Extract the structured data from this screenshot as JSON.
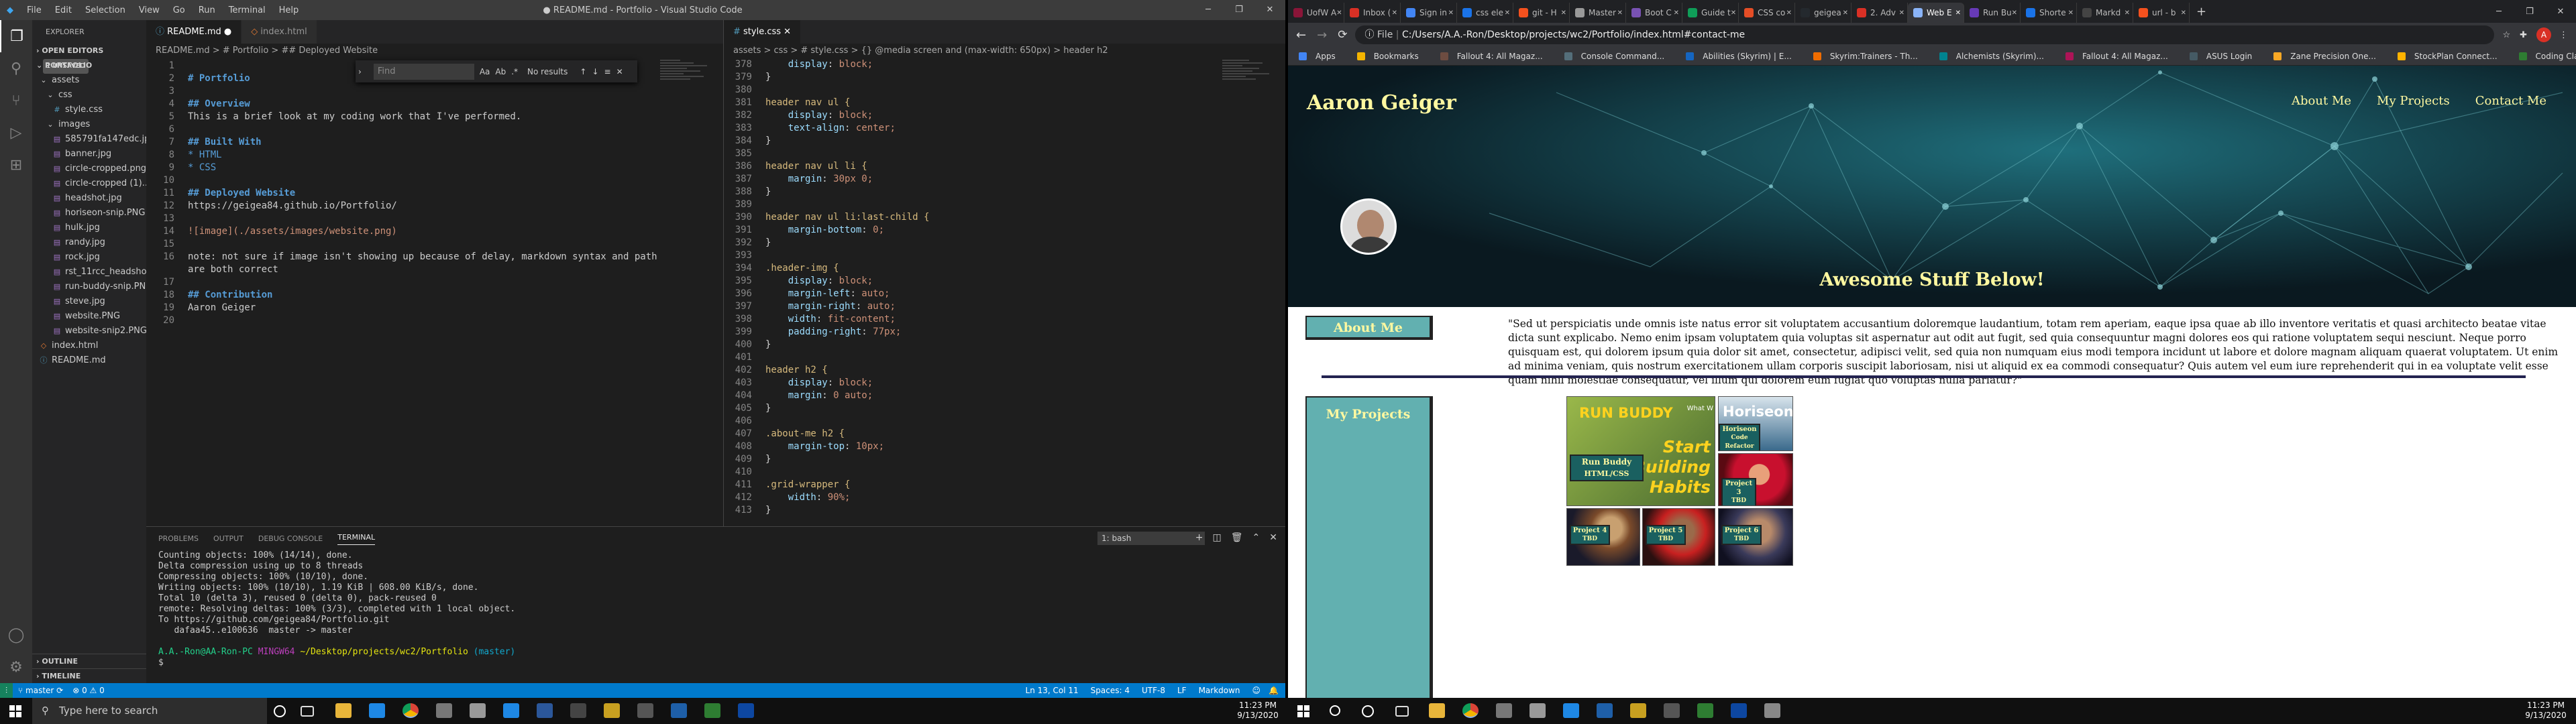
{
  "vscode": {
    "menu": [
      "File",
      "Edit",
      "Selection",
      "View",
      "Go",
      "Run",
      "Terminal",
      "Help"
    ],
    "title": "● README.md - Portfolio - Visual Studio Code",
    "explorer": {
      "header": "EXPLORER",
      "open_editors": "OPEN EDITORS",
      "unsaved": "1 UNSAVED",
      "portfolio": "PORTFOLIO",
      "items": [
        "assets",
        "css",
        "style.css",
        "images",
        "585791fa147edc.jpg",
        "banner.jpg",
        "circle-cropped.png",
        "circle-cropped (1)....",
        "headshot.jpg",
        "horiseon-snip.PNG",
        "hulk.jpg",
        "randy.jpg",
        "rock.jpg",
        "rst_11rcc_headshot...",
        "run-buddy-snip.PNG",
        "steve.jpg",
        "website.PNG",
        "website-snip2.PNG",
        "index.html",
        "README.md"
      ],
      "outline": "OUTLINE",
      "timeline": "TIMELINE"
    },
    "left_editor": {
      "tabs": [
        "README.md",
        "index.html"
      ],
      "breadcrumb": "README.md > # Portfolio > ## Deployed Website",
      "find": {
        "placeholder": "Find",
        "aa": "Aa",
        "ab": "Ab",
        "re": ".*",
        "result": "No results"
      },
      "lines": [
        {
          "n": "1",
          "t": ""
        },
        {
          "n": "2",
          "t": "# Portfolio"
        },
        {
          "n": "3",
          "t": ""
        },
        {
          "n": "4",
          "t": "## Overview"
        },
        {
          "n": "5",
          "t": "This is a brief look at my coding work that I've performed."
        },
        {
          "n": "6",
          "t": ""
        },
        {
          "n": "7",
          "t": "## Built With"
        },
        {
          "n": "8",
          "t": "* HTML"
        },
        {
          "n": "9",
          "t": "* CSS"
        },
        {
          "n": "10",
          "t": ""
        },
        {
          "n": "11",
          "t": "## Deployed Website"
        },
        {
          "n": "12",
          "t": "https://geigea84.github.io/Portfolio/"
        },
        {
          "n": "13",
          "t": ""
        },
        {
          "n": "14",
          "t": "![image](./assets/images/website.png)"
        },
        {
          "n": "15",
          "t": ""
        },
        {
          "n": "16",
          "t": "note: not sure if image isn't showing up because of delay, markdown syntax and path"
        },
        {
          "n": "",
          "t": "are both correct"
        },
        {
          "n": "17",
          "t": ""
        },
        {
          "n": "18",
          "t": "## Contribution"
        },
        {
          "n": "19",
          "t": "Aaron Geiger"
        },
        {
          "n": "20",
          "t": ""
        }
      ]
    },
    "right_editor": {
      "tabs": [
        "style.css"
      ],
      "breadcrumb": "assets > css > # style.css > {} @media screen and (max-width: 650px) > header h2",
      "lines": [
        {
          "n": "378",
          "t": "    display: block;"
        },
        {
          "n": "379",
          "t": "}"
        },
        {
          "n": "380",
          "t": ""
        },
        {
          "n": "381",
          "t": "header nav ul {"
        },
        {
          "n": "382",
          "t": "    display: block;"
        },
        {
          "n": "383",
          "t": "    text-align: center;"
        },
        {
          "n": "384",
          "t": "}"
        },
        {
          "n": "385",
          "t": ""
        },
        {
          "n": "386",
          "t": "header nav ul li {"
        },
        {
          "n": "387",
          "t": "    margin: 30px 0;"
        },
        {
          "n": "388",
          "t": "}"
        },
        {
          "n": "389",
          "t": ""
        },
        {
          "n": "390",
          "t": "header nav ul li:last-child {"
        },
        {
          "n": "391",
          "t": "    margin-bottom: 0;"
        },
        {
          "n": "392",
          "t": "}"
        },
        {
          "n": "393",
          "t": ""
        },
        {
          "n": "394",
          "t": ".header-img {"
        },
        {
          "n": "395",
          "t": "    display: block;"
        },
        {
          "n": "396",
          "t": "    margin-left: auto;"
        },
        {
          "n": "397",
          "t": "    margin-right: auto;"
        },
        {
          "n": "398",
          "t": "    width: fit-content;"
        },
        {
          "n": "399",
          "t": "    padding-right: 77px;"
        },
        {
          "n": "400",
          "t": "}"
        },
        {
          "n": "401",
          "t": ""
        },
        {
          "n": "402",
          "t": "header h2 {"
        },
        {
          "n": "403",
          "t": "    display: block;"
        },
        {
          "n": "404",
          "t": "    margin: 0 auto;"
        },
        {
          "n": "405",
          "t": "}"
        },
        {
          "n": "406",
          "t": ""
        },
        {
          "n": "407",
          "t": ".about-me h2 {"
        },
        {
          "n": "408",
          "t": "    margin-top: 10px;"
        },
        {
          "n": "409",
          "t": "}"
        },
        {
          "n": "410",
          "t": ""
        },
        {
          "n": "411",
          "t": ".grid-wrapper {"
        },
        {
          "n": "412",
          "t": "    width: 90%;"
        },
        {
          "n": "413",
          "t": "}"
        }
      ]
    },
    "panel": {
      "tabs": [
        "PROBLEMS",
        "OUTPUT",
        "DEBUG CONSOLE",
        "TERMINAL"
      ],
      "shell": "1: bash",
      "terminal": [
        "Counting objects: 100% (14/14), done.",
        "Delta compression using up to 8 threads",
        "Compressing objects: 100% (10/10), done.",
        "Writing objects: 100% (10/10), 1.19 KiB | 608.00 KiB/s, done.",
        "Total 10 (delta 3), reused 0 (delta 0), pack-reused 0",
        "remote: Resolving deltas: 100% (3/3), completed with 1 local object.",
        "To https://github.com/geigea84/Portfolio.git",
        "   dafaa45..e100636  master -> master",
        "",
        "A.A.-Ron@AA-Ron-PC MINGW64 ~/Desktop/projects/wc2/Portfolio (master)",
        "$ "
      ]
    },
    "status": {
      "branch": "master",
      "errors": "⊗ 0 ⚠ 0",
      "position": "Ln 13, Col 11",
      "spaces": "Spaces: 4",
      "encoding": "UTF-8",
      "eol": "LF",
      "lang": "Markdown"
    }
  },
  "chrome": {
    "tabs": [
      "UofW A",
      "Inbox (",
      "Sign in",
      "css ele",
      "git - H",
      "Master",
      "Boot C",
      "Guide t",
      "CSS co",
      "geigea",
      "2. Adv",
      "Web E",
      "Run Bu",
      "Shorte",
      "Markd",
      "url - b"
    ],
    "active_tab": 11,
    "url": "C:/Users/A.A.-Ron/Desktop/projects/wc2/Portfolio/index.html#contact-me",
    "file_label": "File",
    "bookmarks": [
      "Apps",
      "Bookmarks",
      "Fallout 4: All Magaz...",
      "Console Command...",
      "Abilities (Skyrim) | E...",
      "Skyrim:Trainers - Th...",
      "Alchemists (Skyrim)...",
      "Fallout 4: All Magaz...",
      "ASUS Login",
      "Zane Precision One...",
      "StockPlan Connect...",
      "Coding Class",
      "Other bookmarks"
    ],
    "site": {
      "brand": "Aaron Geiger",
      "nav": [
        "About Me",
        "My Projects",
        "Contact Me"
      ],
      "banner_text": "Awesome Stuff Below!",
      "about_title": "About Me",
      "about_text": "\"Sed ut perspiciatis unde omnis iste natus error sit voluptatem accusantium doloremque laudantium, totam rem aperiam, eaque ipsa quae ab illo inventore veritatis et quasi architecto beatae vitae dicta sunt explicabo. Nemo enim ipsam voluptatem quia voluptas sit aspernatur aut odit aut fugit, sed quia consequuntur magni dolores eos qui ratione voluptatem sequi nesciunt. Neque porro quisquam est, qui dolorem ipsum quia dolor sit amet, consectetur, adipisci velit, sed quia non numquam eius modi tempora incidunt ut labore et dolore magnam aliquam quaerat voluptatem. Ut enim ad minima veniam, quis nostrum exercitationem ullam corporis suscipit laboriosam, nisi ut aliquid ex ea commodi consequatur? Quis autem vel eum iure reprehenderit qui in ea voluptate velit esse quam nihil molestiae consequatur, vel illum qui dolorem eum fugiat quo voluptas nulla pariatur?\"",
      "projects_title": "My Projects",
      "projects": [
        {
          "name": "Run Buddy",
          "sub": "HTML/CSS",
          "img_title": "RUN BUDDY",
          "img_text": "Start Building Habits",
          "img_corner": "What W"
        },
        {
          "name": "Horiseon",
          "sub": "Code Refactor",
          "img_title": "Horiseon"
        },
        {
          "name": "Project 3",
          "sub": "TBD"
        },
        {
          "name": "Project 4",
          "sub": "TBD"
        },
        {
          "name": "Project 5",
          "sub": "TBD"
        },
        {
          "name": "Project 6",
          "sub": "TBD"
        }
      ]
    }
  },
  "taskbar": {
    "search": "Type here to search",
    "time_left": "11:23 PM",
    "date_left": "9/13/2020",
    "time_right": "11:23 PM",
    "date_right": "9/13/2020"
  }
}
